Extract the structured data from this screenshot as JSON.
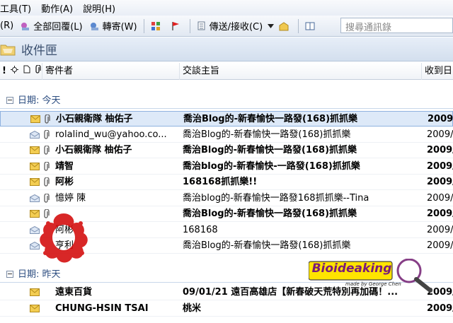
{
  "menu": {
    "items": [
      "工具(T)",
      "動作(A)",
      "說明(H)"
    ]
  },
  "toolbar": {
    "partial_label": "(R)",
    "reply_all": "全部回覆(L)",
    "forward": "轉寄(W)",
    "send_receive": "傳送/接收(C)",
    "search_placeholder": "搜尋通訊錄"
  },
  "folder": {
    "title": "收件匣"
  },
  "columns": {
    "flags": "!",
    "sender": "寄件者",
    "subject": "交談主旨",
    "received": "收到日"
  },
  "groups": [
    {
      "label": "日期: 今天"
    },
    {
      "label": "日期: 昨天"
    }
  ],
  "today_rows": [
    {
      "sender": "小石親衛隊 柚佑子",
      "subject": "喬治Blog的-新春愉快一路發(168)抓抓樂",
      "date": "2009/",
      "unread": true,
      "selected": true,
      "icon": "envelope-icon",
      "attachment": true
    },
    {
      "sender": "rolalind_wu@yahoo.co...",
      "subject": "喬治Blog的-新春愉快一路發(168)抓抓樂",
      "date": "2009/",
      "unread": false,
      "selected": false,
      "icon": "envelope-open-icon",
      "attachment": true
    },
    {
      "sender": "小石親衛隊 柚佑子",
      "subject": "喬治Blog的-新春愉快一路發(168)抓抓樂",
      "date": "2009/",
      "unread": true,
      "selected": false,
      "icon": "envelope-icon",
      "attachment": true
    },
    {
      "sender": "靖智",
      "subject": "喬治blog的-新春愉快-一路發(168)抓抓樂",
      "date": "2009/",
      "unread": true,
      "selected": false,
      "icon": "envelope-icon",
      "attachment": true
    },
    {
      "sender": "阿彬",
      "subject": "168168抓抓樂!!",
      "date": "2009/",
      "unread": true,
      "selected": false,
      "icon": "envelope-icon",
      "attachment": true
    },
    {
      "sender": "憶婷 陳",
      "subject": "喬治blog的-新春愉快一路發168抓抓樂--Tina",
      "date": "2009/",
      "unread": false,
      "selected": false,
      "icon": "envelope-open-icon",
      "attachment": true
    },
    {
      "sender": "",
      "subject": "喬治Blog的-新春愉快一路發(168)抓抓樂",
      "date": "2009/",
      "unread": true,
      "selected": false,
      "icon": "envelope-icon",
      "attachment": true
    },
    {
      "sender": "阿彬",
      "subject": "168168",
      "date": "2009/",
      "unread": false,
      "selected": false,
      "icon": "envelope-open-icon",
      "attachment": false
    },
    {
      "sender": "亨利",
      "subject": "喬治Blog的-新春愉快一路發(168)抓抓樂",
      "date": "2009/",
      "unread": false,
      "selected": false,
      "icon": "envelope-open-icon",
      "attachment": false
    }
  ],
  "yesterday_rows": [
    {
      "sender": "遠東百貨",
      "subject": "09/01/21 遠百高雄店【新春破天荒特別再加碼！...",
      "date": "2009/",
      "unread": true,
      "selected": false,
      "icon": "envelope-icon",
      "attachment": false
    },
    {
      "sender": "CHUNG-HSIN TSAI",
      "subject": "桃米",
      "date": "2009/",
      "unread": true,
      "selected": false,
      "icon": "envelope-icon",
      "attachment": false
    }
  ],
  "watermark": {
    "brand": "Bioideaking",
    "byline": "made by George Chen"
  },
  "colors": {
    "accent": "#2c4d80",
    "selection": "#dde9f8",
    "envelope": "#e8c040"
  }
}
